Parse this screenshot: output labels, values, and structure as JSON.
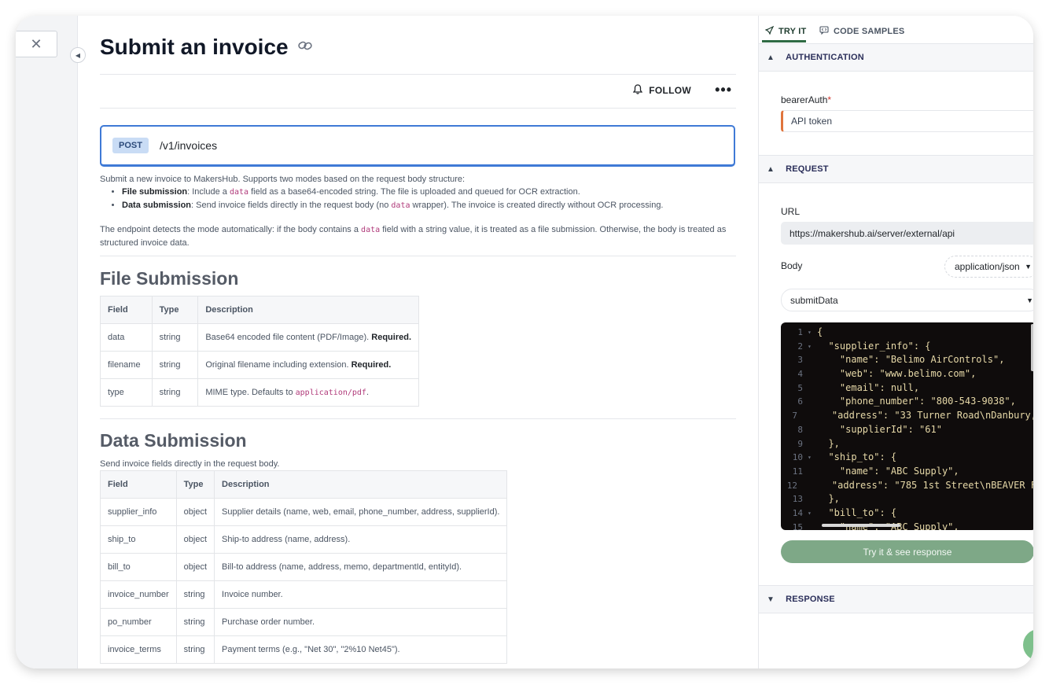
{
  "page": {
    "title": "Submit an invoice",
    "follow_label": "FOLLOW",
    "more_label": "•••",
    "close_label": "✕"
  },
  "endpoint": {
    "method": "POST",
    "path": "/v1/invoices"
  },
  "description": {
    "intro": "Submit a new invoice to MakersHub. Supports two modes based on the request body structure:",
    "bullets": [
      {
        "strong": "File submission",
        "pre": ": Include a ",
        "code": "data",
        "post": " field as a base64-encoded string. The file is uploaded and queued for OCR extraction."
      },
      {
        "strong": "Data submission",
        "pre": ": Send invoice fields directly in the request body (no ",
        "code": "data",
        "post": " wrapper). The invoice is created directly without OCR processing."
      }
    ],
    "note_pre": "The endpoint detects the mode automatically: if the body contains a ",
    "note_code": "data",
    "note_post": " field with a string value, it is treated as a file submission. Otherwise, the body is treated as structured invoice data."
  },
  "file_submission": {
    "heading": "File Submission",
    "headers": [
      "Field",
      "Type",
      "Description"
    ],
    "rows": [
      {
        "field": "data",
        "type": "string",
        "desc": "Base64 encoded file content (PDF/Image). ",
        "strong": "Required.",
        "code": ""
      },
      {
        "field": "filename",
        "type": "string",
        "desc": "Original filename including extension. ",
        "strong": "Required.",
        "code": ""
      },
      {
        "field": "type",
        "type": "string",
        "desc": "MIME type. Defaults to ",
        "strong": "",
        "code": "application/pdf",
        "tail": "."
      }
    ]
  },
  "data_submission": {
    "heading": "Data Submission",
    "subtext": "Send invoice fields directly in the request body.",
    "headers": [
      "Field",
      "Type",
      "Description"
    ],
    "rows": [
      {
        "field": "supplier_info",
        "type": "object",
        "desc": "Supplier details (name, web, email, phone_number, address, supplierId)."
      },
      {
        "field": "ship_to",
        "type": "object",
        "desc": "Ship-to address (name, address)."
      },
      {
        "field": "bill_to",
        "type": "object",
        "desc": "Bill-to address (name, address, memo, departmentId, entityId)."
      },
      {
        "field": "invoice_number",
        "type": "string",
        "desc": "Invoice number."
      },
      {
        "field": "po_number",
        "type": "string",
        "desc": "Purchase order number."
      },
      {
        "field": "invoice_terms",
        "type": "string",
        "desc": "Payment terms (e.g., \"Net 30\", \"2%10 Net45\")."
      }
    ]
  },
  "panel": {
    "tabs": [
      {
        "label": "TRY IT",
        "icon": "rocket-icon"
      },
      {
        "label": "CODE SAMPLES",
        "icon": "code-samples-icon"
      }
    ],
    "auth": {
      "section": "AUTHENTICATION",
      "label": "bearerAuth",
      "required_mark": "*",
      "placeholder": "API token"
    },
    "request": {
      "section": "REQUEST",
      "url_label": "URL",
      "url": "https://makershub.ai/server/external/api",
      "body_label": "Body",
      "content_type": "application/json",
      "example": "submitData",
      "code_lines": [
        {
          "n": "1",
          "fold": "▾",
          "t": "{"
        },
        {
          "n": "2",
          "fold": "▾",
          "t": "  \"supplier_info\": {"
        },
        {
          "n": "3",
          "fold": "",
          "t": "    \"name\": \"Belimo AirControls\","
        },
        {
          "n": "4",
          "fold": "",
          "t": "    \"web\": \"www.belimo.com\","
        },
        {
          "n": "5",
          "fold": "",
          "t": "    \"email\": null,"
        },
        {
          "n": "6",
          "fold": "",
          "t": "    \"phone_number\": \"800-543-9038\","
        },
        {
          "n": "7",
          "fold": "",
          "t": "    \"address\": \"33 Turner Road\\nDanbury,"
        },
        {
          "n": "8",
          "fold": "",
          "t": "    \"supplierId\": \"61\""
        },
        {
          "n": "9",
          "fold": "",
          "t": "  },"
        },
        {
          "n": "10",
          "fold": "▾",
          "t": "  \"ship_to\": {"
        },
        {
          "n": "11",
          "fold": "",
          "t": "    \"name\": \"ABC Supply\","
        },
        {
          "n": "12",
          "fold": "",
          "t": "    \"address\": \"785 1st Street\\nBEAVER F"
        },
        {
          "n": "13",
          "fold": "",
          "t": "  },"
        },
        {
          "n": "14",
          "fold": "▾",
          "t": "  \"bill_to\": {"
        },
        {
          "n": "15",
          "fold": "",
          "t": "    \"name\": \"ABC Supply\","
        }
      ],
      "try_button": "Try it & see response"
    },
    "response": {
      "section": "RESPONSE"
    }
  }
}
